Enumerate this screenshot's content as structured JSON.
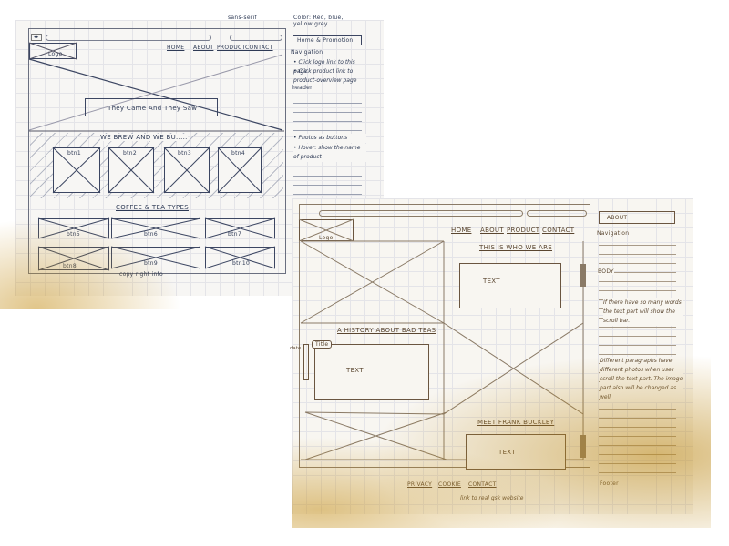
{
  "left_sketch": {
    "top_notes": {
      "font_note": "sans-serif",
      "color_note": "Color: Red, blue, yellow grey"
    },
    "page_title": "Home & Promotion",
    "nav": [
      "HOME",
      "ABOUT",
      "PRODUCT",
      "CONTACT"
    ],
    "logo": "Logo",
    "hero_caption": "They Came And They Saw",
    "section1_title": "WE BREW AND WE BU.....",
    "buttons_row1": [
      "btn1",
      "btn2",
      "btn3",
      "btn4"
    ],
    "section2_title": "COFFEE & TEA TYPES",
    "buttons_row2": [
      "btn5",
      "btn6",
      "btn7"
    ],
    "buttons_row3": [
      "btn8",
      "btn9",
      "btn10"
    ],
    "footer": "copy right info",
    "annotations": {
      "navigation": "Navigation",
      "nav_notes": [
        "• Click logo link to this page",
        "• Click product link to product-overview page"
      ],
      "header": "header",
      "body_notes": [
        "• Photos as buttons",
        "• Hover: show the name of product"
      ]
    }
  },
  "right_sketch": {
    "page_title": "ABOUT",
    "nav": [
      "HOME",
      "ABOUT",
      "PRODUCT",
      "CONTACT"
    ],
    "logo": "Logo",
    "section1_title": "THIS IS WHO WE ARE",
    "text_label": "TEXT",
    "section2_title": "A HISTORY ABOUT BAD TEAS",
    "title_tab": "Title",
    "date_label": "date",
    "section3_title": "MEET FRANK BUCKLEY",
    "footer_links": [
      "PRIVACY",
      "COOKIE",
      "CONTACT"
    ],
    "footer_note": "link to real gsk website",
    "annotations": {
      "navigation": "Navigation",
      "body": "BODY",
      "note1": "If there have so many words the text part will show the scroll bar.",
      "note2": "Different paragraphs have different photos when user scroll the text part. The image part also will be changed as well.",
      "footer": "Footer"
    }
  }
}
